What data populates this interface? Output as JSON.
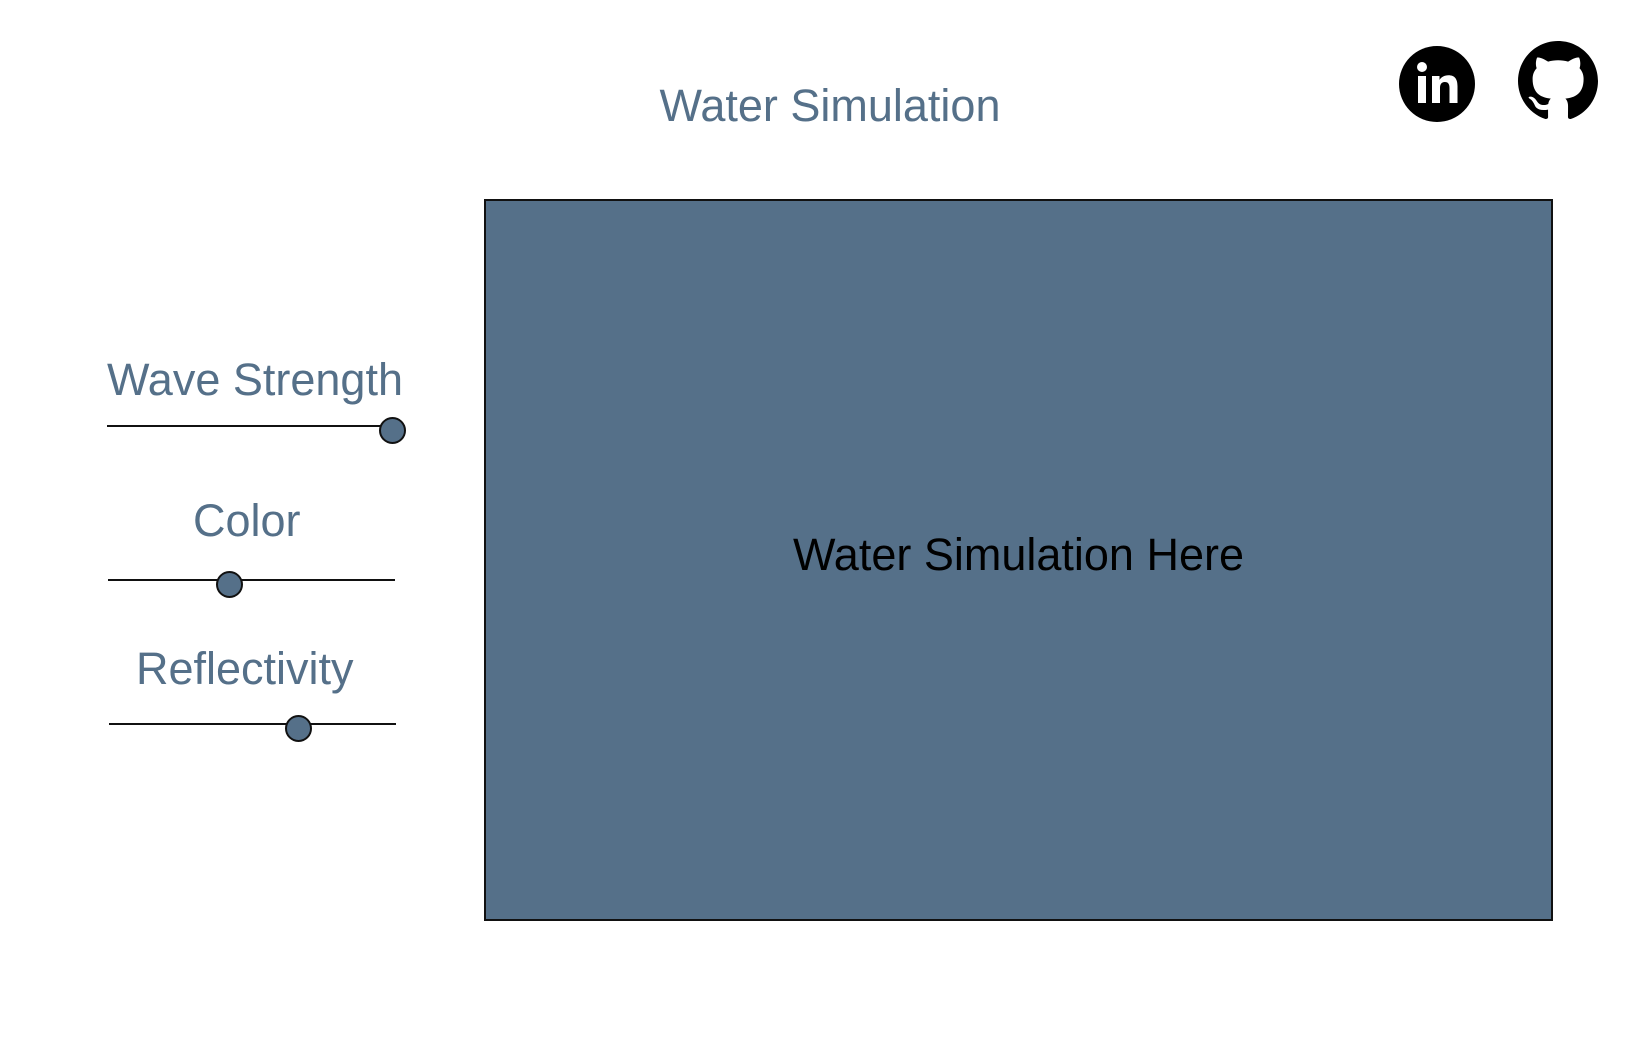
{
  "header": {
    "title": "Water Simulation"
  },
  "social": {
    "linkedin_icon": "linkedin-icon",
    "github_icon": "github-icon"
  },
  "controls": {
    "wave_strength": {
      "label": "Wave Strength",
      "value_fraction": 1.0
    },
    "color": {
      "label": "Color",
      "value_fraction": 0.42
    },
    "reflectivity": {
      "label": "Reflectivity",
      "value_fraction": 0.66
    }
  },
  "simulation": {
    "placeholder_text": "Water Simulation Here",
    "background_color": "#557089"
  },
  "theme": {
    "accent": "#557089",
    "border": "#111111"
  }
}
